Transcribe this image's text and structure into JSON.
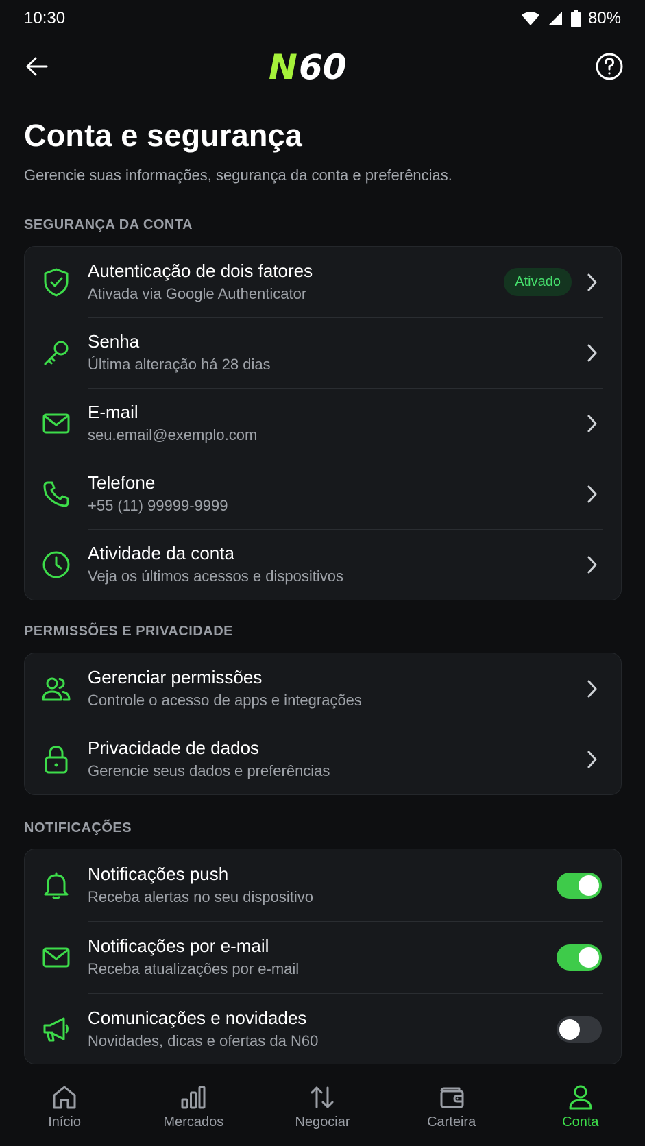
{
  "status_bar": {
    "time": "10:30",
    "battery": "80%"
  },
  "header": {
    "logo_text": "N60"
  },
  "page": {
    "title": "Conta e segurança",
    "subtitle": "Gerencie suas informações, segurança da conta e preferências."
  },
  "sections": {
    "security": {
      "label": "SEGURANÇA DA CONTA",
      "items": [
        {
          "title": "Autenticação de dois fatores",
          "subtitle": "Ativada via Google Authenticator",
          "badge": "Ativado",
          "icon": "shield-check-icon"
        },
        {
          "title": "Senha",
          "subtitle": "Última alteração há 28 dias",
          "icon": "key-icon"
        },
        {
          "title": "E-mail",
          "subtitle": "seu.email@exemplo.com",
          "icon": "mail-icon"
        },
        {
          "title": "Telefone",
          "subtitle": "+55 (11) 99999-9999",
          "icon": "phone-icon"
        },
        {
          "title": "Atividade da conta",
          "subtitle": "Veja os últimos acessos e dispositivos",
          "icon": "clock-icon"
        }
      ]
    },
    "privacy": {
      "label": "PERMISSÕES E PRIVACIDADE",
      "items": [
        {
          "title": "Gerenciar permissões",
          "subtitle": "Controle o acesso de apps e integrações",
          "icon": "users-icon"
        },
        {
          "title": "Privacidade de dados",
          "subtitle": "Gerencie seus dados e preferências",
          "icon": "lock-icon"
        }
      ]
    },
    "notifications": {
      "label": "NOTIFICAÇÕES",
      "items": [
        {
          "title": "Notificações push",
          "subtitle": "Receba alertas no seu dispositivo",
          "enabled": true,
          "icon": "bell-icon"
        },
        {
          "title": "Notificações por e-mail",
          "subtitle": "Receba atualizações por e-mail",
          "enabled": true,
          "icon": "mail-icon"
        },
        {
          "title": "Comunicações e novidades",
          "subtitle": "Novidades, dicas e ofertas da N60",
          "enabled": false,
          "icon": "megaphone-icon"
        }
      ]
    }
  },
  "bottom_nav": [
    {
      "label": "Início",
      "icon": "home-icon",
      "active": false
    },
    {
      "label": "Mercados",
      "icon": "bar-chart-icon",
      "active": false
    },
    {
      "label": "Negociar",
      "icon": "swap-arrows-icon",
      "active": false
    },
    {
      "label": "Carteira",
      "icon": "wallet-icon",
      "active": false
    },
    {
      "label": "Conta",
      "icon": "user-icon",
      "active": true
    }
  ],
  "colors": {
    "accent": "#3ddc4a",
    "background": "#0e0f11",
    "card": "#17191c",
    "badge_bg": "#143520",
    "toggle_on": "#3ecb4a",
    "toggle_off": "#34373c"
  }
}
